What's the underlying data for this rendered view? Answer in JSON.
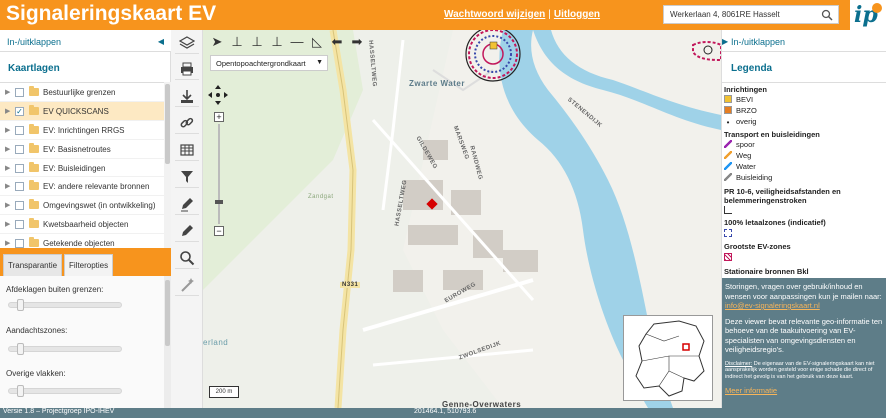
{
  "app": {
    "title": "Signaleringskaart EV",
    "links": {
      "password": "Wachtwoord wijzigen",
      "separator": "|",
      "logout": "Uitloggen"
    },
    "search": {
      "value": "Werkerlaan 4, 8061RE Hasselt"
    },
    "logo": "ip"
  },
  "left_panel": {
    "toggle_label": "In-/uitklappen",
    "section_title": "Kaartlagen",
    "layers": [
      {
        "label": "Bestuurlijke grenzen",
        "checked": false,
        "selected": false
      },
      {
        "label": "EV QUICKSCANS",
        "checked": true,
        "selected": true
      },
      {
        "label": "EV: Inrichtingen RRGS",
        "checked": false,
        "selected": false
      },
      {
        "label": "EV: Basisnetroutes",
        "checked": false,
        "selected": false
      },
      {
        "label": "EV: Buisleidingen",
        "checked": false,
        "selected": false
      },
      {
        "label": "EV: andere relevante bronnen",
        "checked": false,
        "selected": false
      },
      {
        "label": "Omgevingswet (in ontwikkeling)",
        "checked": false,
        "selected": false
      },
      {
        "label": "Kwetsbaarheid objecten",
        "checked": false,
        "selected": false
      },
      {
        "label": "Getekende objecten",
        "checked": false,
        "selected": false
      }
    ],
    "tabs": {
      "transparency": "Transparantie",
      "filter": "Filteropties"
    },
    "transparency": {
      "outside_label": "Afdeklagen buiten grenzen:",
      "attention_label": "Aandachtszones:",
      "other_label": "Overige vlakken:"
    }
  },
  "map": {
    "basemap": "Opentopoachtergrondkaart",
    "scale": "200 m",
    "labels": {
      "zwarte_water": "Zwarte Water",
      "genne_overwaters": "Genne-Overwaters",
      "hasseltweg": "HASSELTWEG",
      "stenendijk": "STENENDIJK",
      "zandgat": "Zandgat",
      "euroweg": "EUROWEG",
      "zwolsedijk": "ZWOLSEDIJK",
      "randweg": "RANDWEG",
      "gildeweg": "GILDEWEG",
      "marsweg": "MARSWEG",
      "n": "N331",
      "berland": "erland"
    }
  },
  "right_panel": {
    "toggle_label": "In-/uitklappen",
    "legend_title": "Legenda",
    "legend": {
      "inrichtingen": "Inrichtingen",
      "bevi": "BEVI",
      "brzo": "BRZO",
      "overig": "overig",
      "transport": "Transport en buisleidingen",
      "spoor": "spoor",
      "weg": "Weg",
      "water": "Water",
      "buisleiding": "Buisleiding",
      "pr": "PR 10-6, veiligheidsafstanden en belemmeringenstroken",
      "letaal": "100% letaalzones (indicatief)",
      "grootste": "Grootste EV-zones",
      "stationaire": "Stationaire bronnen Bkl"
    },
    "info": {
      "p1_text": "Storingen, vragen over gebruik/inhoud en wensen voor aanpassingen kun je mailen naar:",
      "p1_link": "info@ev-signaleringskaart.nl",
      "p2": "Deze viewer bevat relevante geo-informatie ten behoeve van de taakuitvoering van EV-specialisten van omgevingsdiensten en veiligheidsregio's.",
      "disclaimer_label": "Disclaimer:",
      "disclaimer": "De eigenaar van de EV-signaleringskaart kan niet aansprakelijk worden gesteld voor enige schade die direct of indirect het gevolg is van het gebruik van deze kaart.",
      "more": "Meer informatie"
    }
  },
  "status": {
    "version": "Versie 1.8 – Projectgroep IPO-IHEV",
    "coords": "201464.1, 510793.6"
  },
  "colors": {
    "accent": "#f7941d",
    "brand": "#0b6f8e",
    "footer": "#5e7d88"
  }
}
